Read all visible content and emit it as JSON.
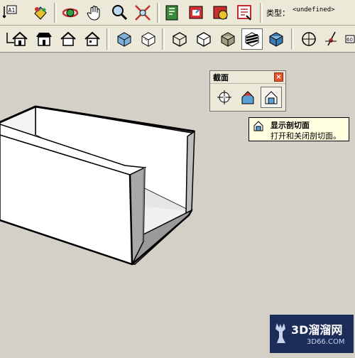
{
  "toolbar_top": {
    "type_label": "类型：",
    "type_value": "<undefined>",
    "text_tool_glyph": "A1"
  },
  "toolbar_views": {
    "buttons": [
      "iso-view",
      "top-view",
      "front-view",
      "right-view",
      "back-view",
      "left-view",
      "xray-style",
      "wireframe-style",
      "hidden-line-style",
      "shaded-style",
      "textured-style",
      "monochrome-style",
      "section-plane",
      "position-camera",
      "walk",
      "look-around"
    ]
  },
  "section_panel": {
    "title": "截面",
    "close_glyph": "×"
  },
  "tooltip": {
    "title": "显示剖切面",
    "description": "打开和关闭剖切面。"
  },
  "watermark": {
    "brand": "3D溜溜网",
    "url": "3D66.COM"
  },
  "colors": {
    "background": "#d4d0c8",
    "toolbar": "#ece9d8",
    "tooltip_bg": "#ffffe1",
    "watermark_bg": "#1d2d5a",
    "close_button": "#e4512b"
  }
}
